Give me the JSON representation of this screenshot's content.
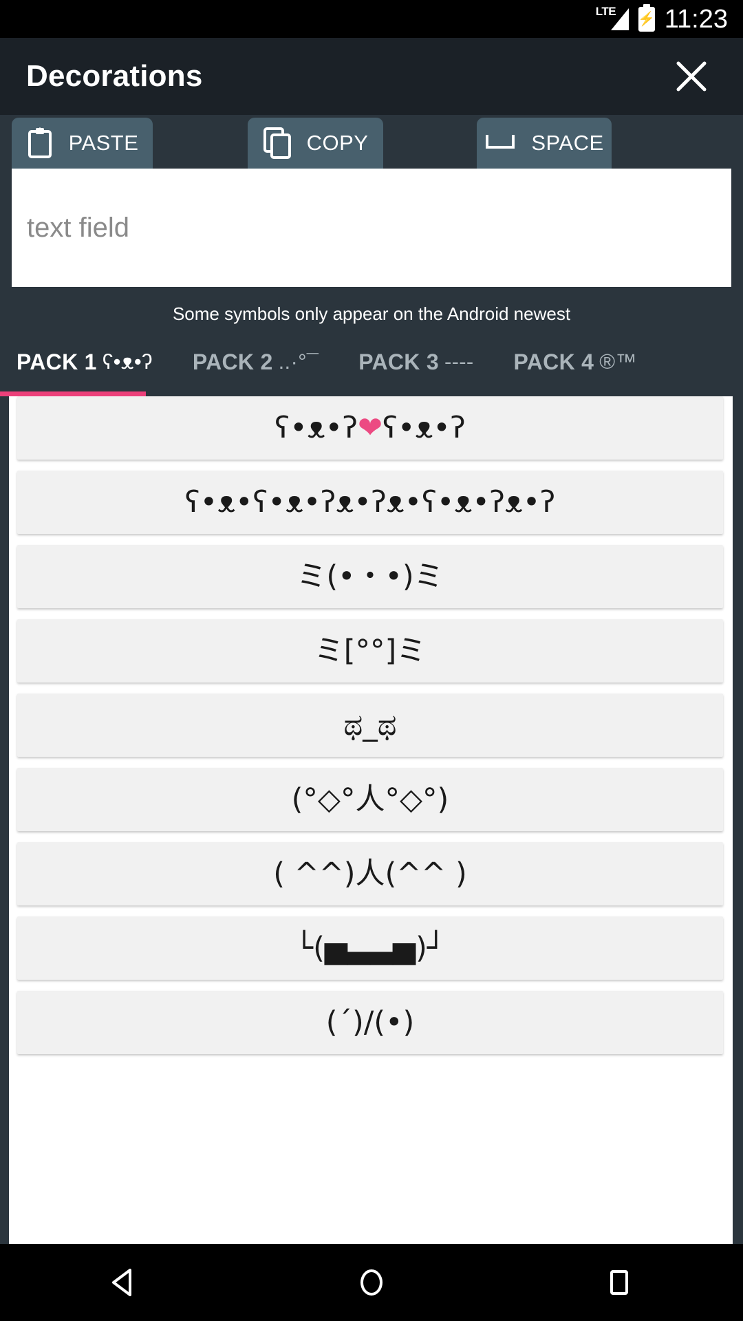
{
  "status_bar": {
    "network_label": "LTE",
    "signal_icon": "signal-bars-icon",
    "battery_icon": "battery-charging-icon",
    "clock": "11:23"
  },
  "app_bar": {
    "title": "Decorations",
    "close_icon": "close-icon"
  },
  "toolbar": {
    "paste_label": "PASTE",
    "paste_icon": "clipboard-paste-icon",
    "copy_label": "COPY",
    "copy_icon": "copy-icon",
    "space_label": "SPACE",
    "space_icon": "spacebar-icon"
  },
  "text_field": {
    "value": "",
    "placeholder": "text field"
  },
  "hint": {
    "text": "Some symbols only appear on the Android newest"
  },
  "tabs": {
    "active_index": 0,
    "indicator_color": "#ec407a",
    "items": [
      {
        "label": "PACK 1",
        "glyph": "ʕ•ᴥ•ʔ"
      },
      {
        "label": "PACK 2",
        "glyph": "..·°¯"
      },
      {
        "label": "PACK 3",
        "glyph": "----"
      },
      {
        "label": "PACK 4",
        "glyph": "®™"
      }
    ]
  },
  "list": {
    "items": [
      {
        "pre": "ʕ•ᴥ•ʔ",
        "heart": "❤",
        "post": "ʕ•ᴥ•ʔ"
      },
      {
        "text": "ʕ•ᴥ•ʕ•ᴥ•ʔᴥ•ʔᴥ•ʕ•ᴥ•ʔᴥ•ʔ"
      },
      {
        "text": "ミ(•・•)ミ"
      },
      {
        "text": "ミ[°°]ミ"
      },
      {
        "text": "ಥ_ಥ"
      },
      {
        "text": "(°◇°人°◇°)"
      },
      {
        "text": "( ^^)人(^^ )"
      },
      {
        "text": "└(▅▃▃▅)┘"
      },
      {
        "text": "(´)/(•)"
      }
    ]
  },
  "nav_bar": {
    "back_icon": "back-triangle-icon",
    "home_icon": "home-circle-icon",
    "recents_icon": "recents-square-icon"
  },
  "colors": {
    "accent": "#ec407a",
    "app_bar_bg": "#1b2127",
    "panel_bg": "#2b353d",
    "button_bg": "#48606d",
    "list_item_bg": "#f1f1f1"
  }
}
